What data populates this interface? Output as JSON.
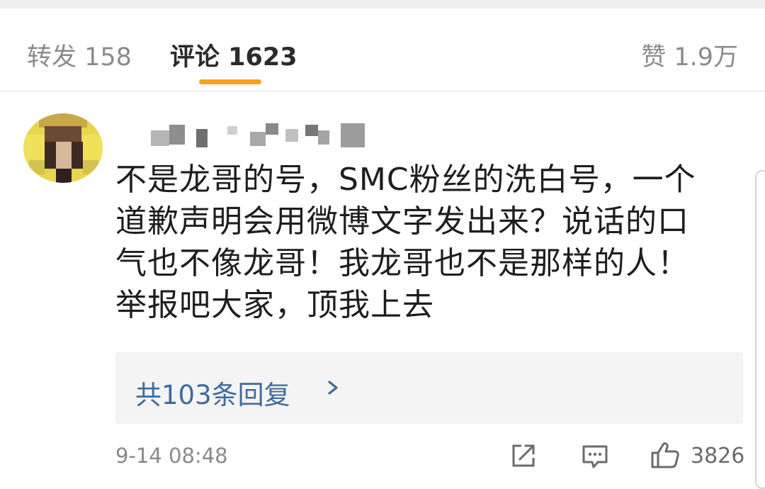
{
  "tabs": {
    "repost": "转发 158",
    "comments": "评论 1623",
    "like": "赞 1.9万"
  },
  "comment": {
    "lines": [
      "不是龙哥的号，SMC粉丝的洗白号，一个",
      "道歉声明会用微博文字发出来？说话的口",
      "气也不像龙哥！我龙哥也不是那样的人！",
      "举报吧大家，顶我上去"
    ],
    "replies_label": "共103条回复",
    "timestamp": "9-14 08:48",
    "like_count": "3826"
  },
  "icons": {
    "share": "share-icon",
    "reply": "comment-icon",
    "like": "thumbs-up-icon",
    "chevron": "chevron-right-icon"
  },
  "colors": {
    "accent": "#f7a41a",
    "link": "#3f6b9a"
  }
}
